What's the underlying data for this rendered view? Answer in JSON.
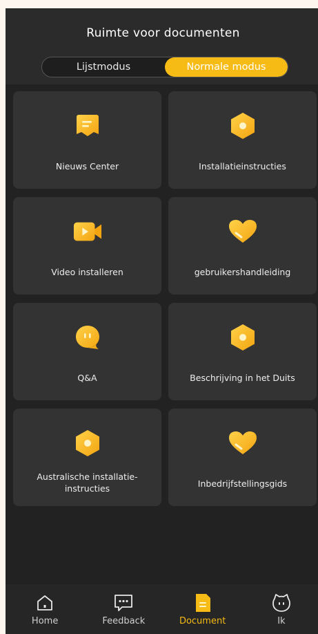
{
  "header": {
    "title": "Ruimte voor documenten",
    "modes": [
      "Lijstmodus",
      "Normale modus"
    ],
    "active_mode": "Normale modus"
  },
  "cards": [
    {
      "label": "Nieuws Center",
      "icon": "news-icon"
    },
    {
      "label": "Installatieinstructies",
      "icon": "hexagon-icon"
    },
    {
      "label": "Video installeren",
      "icon": "video-icon"
    },
    {
      "label": "gebruikershandleiding",
      "icon": "heart-icon"
    },
    {
      "label": "Q&A",
      "icon": "chat-bubble-icon"
    },
    {
      "label": "Beschrijving in het Duits",
      "icon": "hexagon-icon"
    },
    {
      "label": "Australische installatie-\ninstructies",
      "icon": "hexagon-icon"
    },
    {
      "label": "Inbedrijfstellingsgids",
      "icon": "heart-icon"
    }
  ],
  "tabbar": {
    "items": [
      {
        "label": "Home",
        "icon": "home-icon"
      },
      {
        "label": "Feedback",
        "icon": "feedback-icon"
      },
      {
        "label": "Document",
        "icon": "document-icon"
      },
      {
        "label": "Ik",
        "icon": "profile-icon"
      }
    ],
    "active": "Document"
  },
  "colors": {
    "accent": "#f6bb14",
    "background": "#222222",
    "card": "#333333",
    "text": "#eeeeee"
  }
}
